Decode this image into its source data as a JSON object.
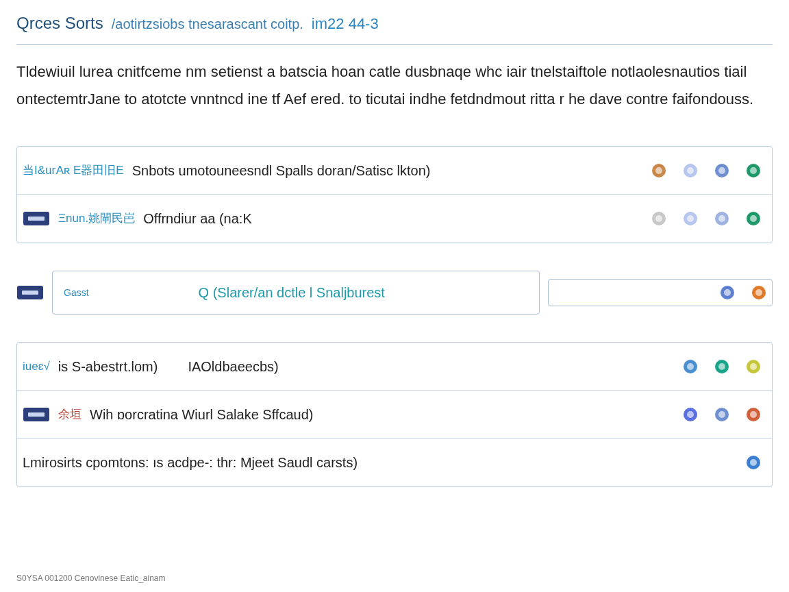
{
  "header": {
    "title": "Qrces Sorts",
    "subtitle": "/aotirtzsiobs tnesarascant coitp.",
    "code": "im22 44-3"
  },
  "intro": "Tldewiuil lurea cnitfceme nm setienst a batscia hoan catle dusbnaqe whc iair tnelstaiftole notlaolesnautios tiail ontectemtrJane to atotcte vnntncd ine tf Aef ered. to ticutai indhe fetdndmout ritta r he dave contre faifondouss.",
  "groups": [
    {
      "rows": [
        {
          "kind": "plain",
          "tag": "当I&uᴦAʀ E器田旧E",
          "color": "#2b8fc0",
          "text": "Snbots umotouneesndl Spalls doran/Satisc lkton)",
          "icons": [
            {
              "color": "#c9874a"
            },
            {
              "color": "#b7c6ee"
            },
            {
              "color": "#6f8fd0"
            },
            {
              "color": "#1e9a6a"
            }
          ]
        },
        {
          "kind": "badge",
          "tag": "Ξnun.姚閘民岜",
          "color": "#2b8fc0",
          "text": "Offrndiur aa (na:K",
          "icons": [
            {
              "color": "#c8c8c8"
            },
            {
              "color": "#b7c6ee"
            },
            {
              "color": "#9fb2e0"
            },
            {
              "color": "#1e9a6a"
            }
          ]
        }
      ]
    },
    {
      "rows": [
        {
          "kind": "field",
          "tag": "Gasst",
          "text": "Q (Slarer/an dctle l Snaljburest",
          "icons": [
            {
              "color": "#5f80d0"
            },
            {
              "color": "#e07a2a"
            }
          ]
        }
      ]
    },
    {
      "rows": [
        {
          "kind": "plain",
          "tag": "iueɛ√",
          "color": "#2b8fc0",
          "text": "is S-abestrt.lom)",
          "extra": "IAOldbaeecbs)",
          "icons": [
            {
              "color": "#4a8fd0"
            },
            {
              "color": "#19a58a"
            },
            {
              "color": "#c6c63a"
            }
          ]
        },
        {
          "kind": "badge",
          "tag": "余垣",
          "color": "#c0392b",
          "text": "Wih ɒorcratina Wiurl Salake Sffcaud)",
          "icons": [
            {
              "color": "#5a6fe0"
            },
            {
              "color": "#6f8fd0"
            },
            {
              "color": "#d0603a"
            }
          ]
        },
        {
          "kind": "plain",
          "text": "Lmirosirts cpomtons: ıs acdpe-: thr: Mjeet Saudl carsts)",
          "icons": [
            {
              "color": "#3a7fd0"
            }
          ]
        }
      ]
    }
  ],
  "footer": "S0YSA 001200 Cenovinese Eatic_ainam"
}
